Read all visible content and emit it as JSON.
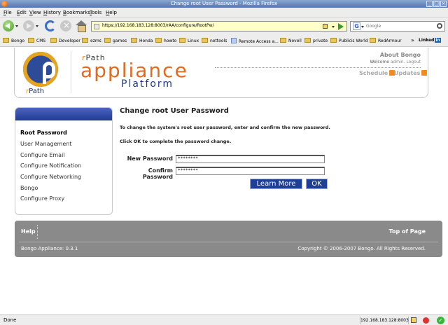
{
  "window": {
    "title": "Change root User Password - Mozilla Firefox"
  },
  "menu": {
    "items": [
      {
        "label": "File",
        "key": "F",
        "rest": "ile"
      },
      {
        "label": "Edit",
        "key": "E",
        "rest": "dit"
      },
      {
        "label": "View",
        "key": "V",
        "rest": "iew"
      },
      {
        "label": "History",
        "key": "H",
        "rest": "istory"
      },
      {
        "label": "Bookmarks",
        "key": "B",
        "rest": "ookmarks"
      },
      {
        "label": "Tools",
        "key": "T",
        "rest": "ools"
      },
      {
        "label": "Help",
        "key": "H",
        "rest": "elp"
      }
    ]
  },
  "nav": {
    "url": "https://192.168.183.128:8003/rAA/configure/RootPw/",
    "search_placeholder": "Google"
  },
  "bookmarks": {
    "items": [
      "Bongo",
      "CMS",
      "Developer",
      "ezms",
      "games",
      "Honda",
      "howto",
      "Linux",
      "nettools",
      "Remote Access a...",
      "Novell",
      "private",
      "Publicis World",
      "RedArmour"
    ],
    "more": "»",
    "linkedin_text": "Linked",
    "linkedin_box": "in"
  },
  "header": {
    "logo_r": "r",
    "logo_path": "Path",
    "brand_r": "r",
    "brand_path": "Path",
    "brand_appliance": "appliance",
    "brand_platform": "Platform",
    "about": "About Bongo",
    "welcome_prefix": "Welcome",
    "welcome_user": "admin.",
    "logout": "Logout",
    "schedule": "Schedule",
    "updates": "Updates"
  },
  "sidebar": {
    "items": [
      {
        "label": "Root Password",
        "active": true
      },
      {
        "label": "User Management"
      },
      {
        "label": "Configure Email"
      },
      {
        "label": "Configure Notification"
      },
      {
        "label": "Configure Networking"
      },
      {
        "label": "Bongo"
      },
      {
        "label": "Configure Proxy"
      }
    ]
  },
  "main": {
    "title": "Change root User Password",
    "instruction1": "To change the system's root user password, enter and confirm the new password.",
    "instruction2": "Click OK to complete the password change.",
    "new_password_label": "New Password",
    "new_password_value": "********",
    "confirm_password_label": "Confirm Password",
    "confirm_password_value": "********",
    "learn_more_button": "Learn More",
    "ok_button": "OK"
  },
  "footer": {
    "help": "Help",
    "top_of_page": "Top of Page",
    "version": "Bongo Appliance: 0.3.1",
    "copyright": "Copyright © 2006-2007 Bongo. All Rights Reserved."
  },
  "status": {
    "text": "Done",
    "host": "192.168.183.128:8003",
    "check": "✓"
  },
  "colors": {
    "brand_orange": "#e36a1c",
    "brand_blue": "#1d3a8a",
    "button_blue": "#1e3f95",
    "footer_gray": "#8a8a8a"
  }
}
